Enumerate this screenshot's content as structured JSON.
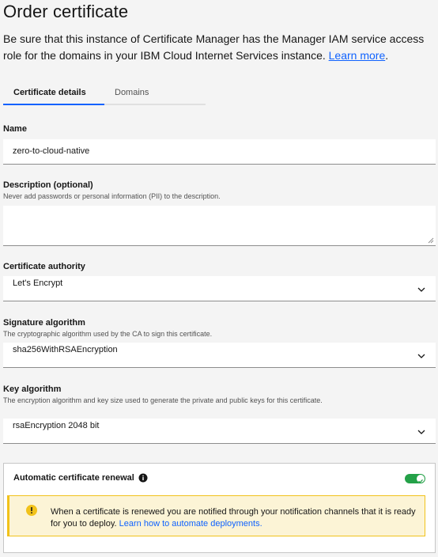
{
  "page": {
    "title": "Order certificate",
    "intro_text": "Be sure that this instance of Certificate Manager has the Manager IAM service access role for the domains in your IBM Cloud Internet Services instance.",
    "learn_more": "Learn more",
    "intro_suffix": "."
  },
  "tabs": [
    {
      "label": "Certificate details",
      "active": true
    },
    {
      "label": "Domains",
      "active": false
    }
  ],
  "name": {
    "label": "Name",
    "value": "zero-to-cloud-native"
  },
  "description": {
    "label": "Description (optional)",
    "helper": "Never add passwords or personal information (PII) to the description.",
    "value": ""
  },
  "certificate_authority": {
    "label": "Certificate authority",
    "value": "Let's Encrypt"
  },
  "signature_algorithm": {
    "label": "Signature algorithm",
    "helper": "The cryptographic algorithm used by the CA to sign this certificate.",
    "value": "sha256WithRSAEncryption"
  },
  "key_algorithm": {
    "label": "Key algorithm",
    "helper": "The encryption algorithm and key size used to generate the private and public keys for this certificate.",
    "value": "rsaEncryption 2048 bit"
  },
  "renewal": {
    "label": "Automatic certificate renewal",
    "enabled": true,
    "notice_text": "When a certificate is renewed you are notified through your notification channels that it is ready for you to deploy.",
    "notice_link": "Learn how to automate deployments."
  },
  "colors": {
    "link": "#0f62fe",
    "toggle_on": "#24a148",
    "warning": "#f1c21b",
    "warning_bg": "#fcf4d6"
  }
}
